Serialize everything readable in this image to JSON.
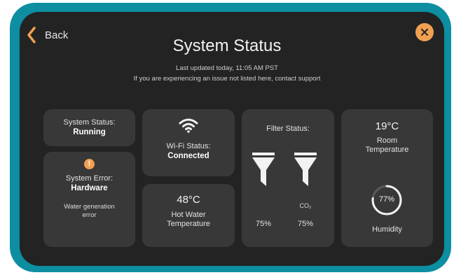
{
  "nav": {
    "back_label": "Back"
  },
  "header": {
    "title": "System Status",
    "last_updated": "Last updated today, 11:05 AM PST",
    "support_text": "If you are experiencing an issue not listed here, contact support"
  },
  "system_status": {
    "label": "System Status:",
    "value": "Running"
  },
  "system_error": {
    "label": "System Error:",
    "value": "Hardware",
    "detail_line1": "Water generation",
    "detail_line2": "error"
  },
  "wifi": {
    "label": "Wi-Fi Status:",
    "value": "Connected"
  },
  "hot_water": {
    "temperature": "48°C",
    "label_line1": "Hot Water",
    "label_line2": "Temperature"
  },
  "filter": {
    "label": "Filter Status:",
    "filters": [
      {
        "name": "",
        "percent": "75%"
      },
      {
        "name": "CO₂",
        "percent": "75%"
      }
    ]
  },
  "room": {
    "temperature": "19°C",
    "label_line1": "Room",
    "label_line2": "Temperature"
  },
  "humidity": {
    "percent": "77%",
    "level": 0.77,
    "label": "Humidity"
  },
  "colors": {
    "bezel": "#0d8ea1",
    "screen": "#232323",
    "card": "#383838",
    "accent_orange": "#f1a052"
  }
}
